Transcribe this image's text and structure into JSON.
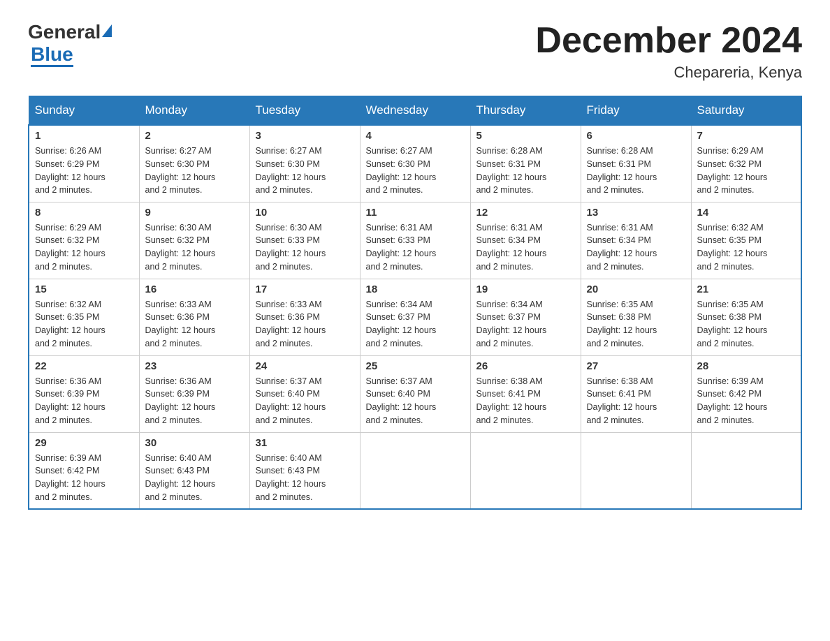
{
  "header": {
    "logo_general": "General",
    "logo_blue": "Blue",
    "month_title": "December 2024",
    "location": "Chepareria, Kenya"
  },
  "days_of_week": [
    "Sunday",
    "Monday",
    "Tuesday",
    "Wednesday",
    "Thursday",
    "Friday",
    "Saturday"
  ],
  "weeks": [
    [
      {
        "day": "1",
        "sunrise": "6:26 AM",
        "sunset": "6:29 PM",
        "daylight": "12 hours and 2 minutes."
      },
      {
        "day": "2",
        "sunrise": "6:27 AM",
        "sunset": "6:30 PM",
        "daylight": "12 hours and 2 minutes."
      },
      {
        "day": "3",
        "sunrise": "6:27 AM",
        "sunset": "6:30 PM",
        "daylight": "12 hours and 2 minutes."
      },
      {
        "day": "4",
        "sunrise": "6:27 AM",
        "sunset": "6:30 PM",
        "daylight": "12 hours and 2 minutes."
      },
      {
        "day": "5",
        "sunrise": "6:28 AM",
        "sunset": "6:31 PM",
        "daylight": "12 hours and 2 minutes."
      },
      {
        "day": "6",
        "sunrise": "6:28 AM",
        "sunset": "6:31 PM",
        "daylight": "12 hours and 2 minutes."
      },
      {
        "day": "7",
        "sunrise": "6:29 AM",
        "sunset": "6:32 PM",
        "daylight": "12 hours and 2 minutes."
      }
    ],
    [
      {
        "day": "8",
        "sunrise": "6:29 AM",
        "sunset": "6:32 PM",
        "daylight": "12 hours and 2 minutes."
      },
      {
        "day": "9",
        "sunrise": "6:30 AM",
        "sunset": "6:32 PM",
        "daylight": "12 hours and 2 minutes."
      },
      {
        "day": "10",
        "sunrise": "6:30 AM",
        "sunset": "6:33 PM",
        "daylight": "12 hours and 2 minutes."
      },
      {
        "day": "11",
        "sunrise": "6:31 AM",
        "sunset": "6:33 PM",
        "daylight": "12 hours and 2 minutes."
      },
      {
        "day": "12",
        "sunrise": "6:31 AM",
        "sunset": "6:34 PM",
        "daylight": "12 hours and 2 minutes."
      },
      {
        "day": "13",
        "sunrise": "6:31 AM",
        "sunset": "6:34 PM",
        "daylight": "12 hours and 2 minutes."
      },
      {
        "day": "14",
        "sunrise": "6:32 AM",
        "sunset": "6:35 PM",
        "daylight": "12 hours and 2 minutes."
      }
    ],
    [
      {
        "day": "15",
        "sunrise": "6:32 AM",
        "sunset": "6:35 PM",
        "daylight": "12 hours and 2 minutes."
      },
      {
        "day": "16",
        "sunrise": "6:33 AM",
        "sunset": "6:36 PM",
        "daylight": "12 hours and 2 minutes."
      },
      {
        "day": "17",
        "sunrise": "6:33 AM",
        "sunset": "6:36 PM",
        "daylight": "12 hours and 2 minutes."
      },
      {
        "day": "18",
        "sunrise": "6:34 AM",
        "sunset": "6:37 PM",
        "daylight": "12 hours and 2 minutes."
      },
      {
        "day": "19",
        "sunrise": "6:34 AM",
        "sunset": "6:37 PM",
        "daylight": "12 hours and 2 minutes."
      },
      {
        "day": "20",
        "sunrise": "6:35 AM",
        "sunset": "6:38 PM",
        "daylight": "12 hours and 2 minutes."
      },
      {
        "day": "21",
        "sunrise": "6:35 AM",
        "sunset": "6:38 PM",
        "daylight": "12 hours and 2 minutes."
      }
    ],
    [
      {
        "day": "22",
        "sunrise": "6:36 AM",
        "sunset": "6:39 PM",
        "daylight": "12 hours and 2 minutes."
      },
      {
        "day": "23",
        "sunrise": "6:36 AM",
        "sunset": "6:39 PM",
        "daylight": "12 hours and 2 minutes."
      },
      {
        "day": "24",
        "sunrise": "6:37 AM",
        "sunset": "6:40 PM",
        "daylight": "12 hours and 2 minutes."
      },
      {
        "day": "25",
        "sunrise": "6:37 AM",
        "sunset": "6:40 PM",
        "daylight": "12 hours and 2 minutes."
      },
      {
        "day": "26",
        "sunrise": "6:38 AM",
        "sunset": "6:41 PM",
        "daylight": "12 hours and 2 minutes."
      },
      {
        "day": "27",
        "sunrise": "6:38 AM",
        "sunset": "6:41 PM",
        "daylight": "12 hours and 2 minutes."
      },
      {
        "day": "28",
        "sunrise": "6:39 AM",
        "sunset": "6:42 PM",
        "daylight": "12 hours and 2 minutes."
      }
    ],
    [
      {
        "day": "29",
        "sunrise": "6:39 AM",
        "sunset": "6:42 PM",
        "daylight": "12 hours and 2 minutes."
      },
      {
        "day": "30",
        "sunrise": "6:40 AM",
        "sunset": "6:43 PM",
        "daylight": "12 hours and 2 minutes."
      },
      {
        "day": "31",
        "sunrise": "6:40 AM",
        "sunset": "6:43 PM",
        "daylight": "12 hours and 2 minutes."
      },
      null,
      null,
      null,
      null
    ]
  ],
  "labels": {
    "sunrise": "Sunrise:",
    "sunset": "Sunset:",
    "daylight": "Daylight:"
  }
}
